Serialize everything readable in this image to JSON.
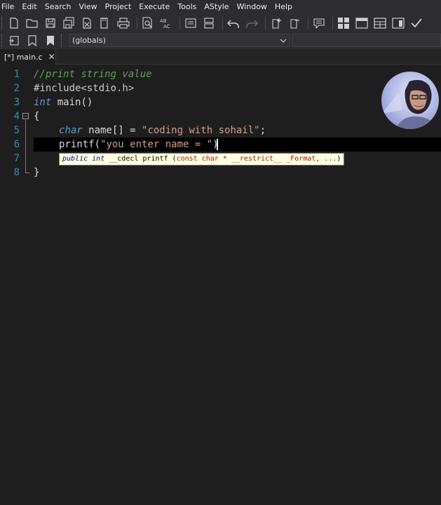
{
  "menu": [
    "File",
    "Edit",
    "Search",
    "View",
    "Project",
    "Execute",
    "Tools",
    "AStyle",
    "Window",
    "Help"
  ],
  "toolbar2": {
    "scope_value": "(globals)"
  },
  "tab": {
    "label": "[*] main.c",
    "close": "✕"
  },
  "editor": {
    "line_numbers": [
      "1",
      "2",
      "3",
      "4",
      "5",
      "6",
      "7",
      "8"
    ],
    "line1": "//print string value",
    "line2": "#include<stdio.h>",
    "line3_kw": "int",
    "line3_rest": " main()",
    "line4": "{",
    "line5_kw": "char",
    "line5_mid": " name[] = ",
    "line5_str": "\"coding with sohail\"",
    "line5_end": ";",
    "line6_a": "printf(",
    "line6_str": "\"you enter name = ",
    "line6_quote": "\"",
    "line6_end": ")",
    "line8": "}"
  },
  "tooltip": {
    "kw1": "public",
    "kw2": "int",
    "fn": " __cdecl printf (",
    "params": "const char * __restrict__ _Format, ...",
    "close": ")"
  }
}
